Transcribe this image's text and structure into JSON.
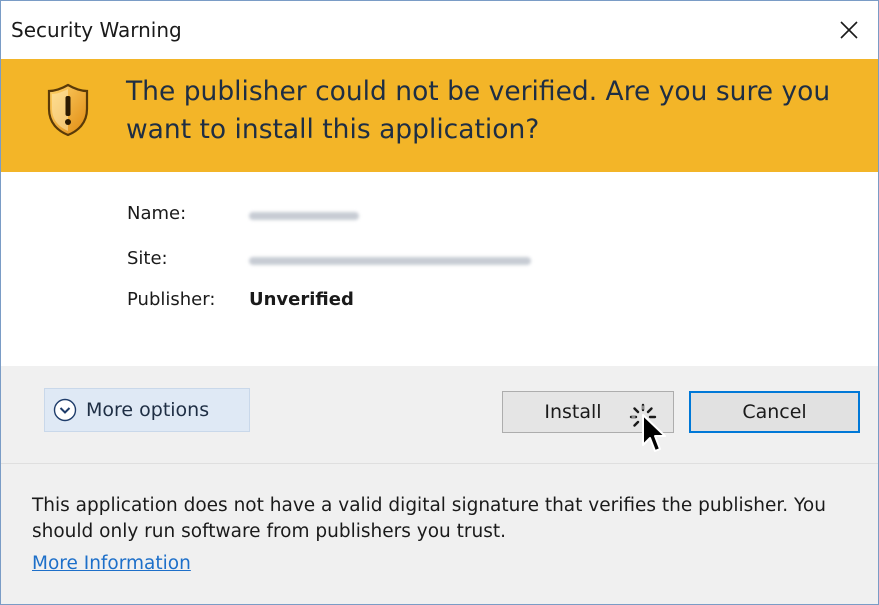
{
  "window": {
    "title": "Security Warning",
    "close_icon": "close-icon"
  },
  "banner": {
    "icon": "shield-warning-icon",
    "message": "The publisher could not be verified. Are you sure you want to install this application?",
    "color": "#f3b528"
  },
  "details": {
    "name_label": "Name:",
    "site_label": "Site:",
    "publisher_label": "Publisher:",
    "publisher_value": "Unverified"
  },
  "actions": {
    "more_options_label": "More options",
    "install_label": "Install",
    "cancel_label": "Cancel",
    "accent": "#0078d7"
  },
  "footer": {
    "message": "This application does not have a valid digital signature that verifies the publisher. You should only run software from publishers you trust.",
    "link_label": "More Information"
  }
}
